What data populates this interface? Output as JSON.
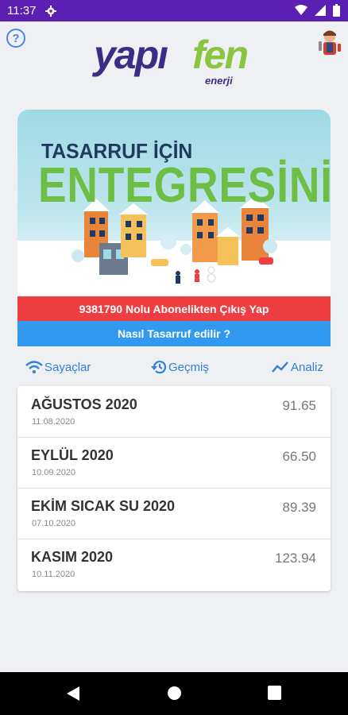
{
  "status": {
    "time": "11:37",
    "icons": [
      "gear-icon",
      "wifi-icon",
      "signal-icon",
      "battery-icon"
    ]
  },
  "header": {
    "help_label": "?",
    "logo_word1": "yapı",
    "logo_word2": "fen",
    "logo_sub": "enerji",
    "logo_colors": {
      "primary": "#3b2d86",
      "accent": "#8bc53f"
    }
  },
  "banner": {
    "line1": "TASARRUF İÇİN",
    "line2": "ENTEGRESİNİZ!"
  },
  "actions": {
    "exit_subscription": "9381790 Nolu Abonelikten Çıkış Yap",
    "how_to_save": "Nasıl Tasarruf edilir ?",
    "exit_color": "#ef3e42",
    "how_color": "#3199f0"
  },
  "tabs": [
    {
      "label": "Sayaçlar",
      "icon": "wifi-icon"
    },
    {
      "label": "Geçmiş",
      "icon": "history-icon"
    },
    {
      "label": "Analiz",
      "icon": "trend-icon"
    }
  ],
  "bills": [
    {
      "title": "AĞUSTOS 2020",
      "date": "11.08.2020",
      "amount": "91.65"
    },
    {
      "title": "EYLÜL 2020",
      "date": "10.09.2020",
      "amount": "66.50"
    },
    {
      "title": "EKİM SICAK SU 2020",
      "date": "07.10.2020",
      "amount": "89.39"
    },
    {
      "title": "KASIM 2020",
      "date": "10.11.2020",
      "amount": "123.94"
    }
  ],
  "nav": [
    "back-icon",
    "home-icon",
    "recents-icon"
  ]
}
